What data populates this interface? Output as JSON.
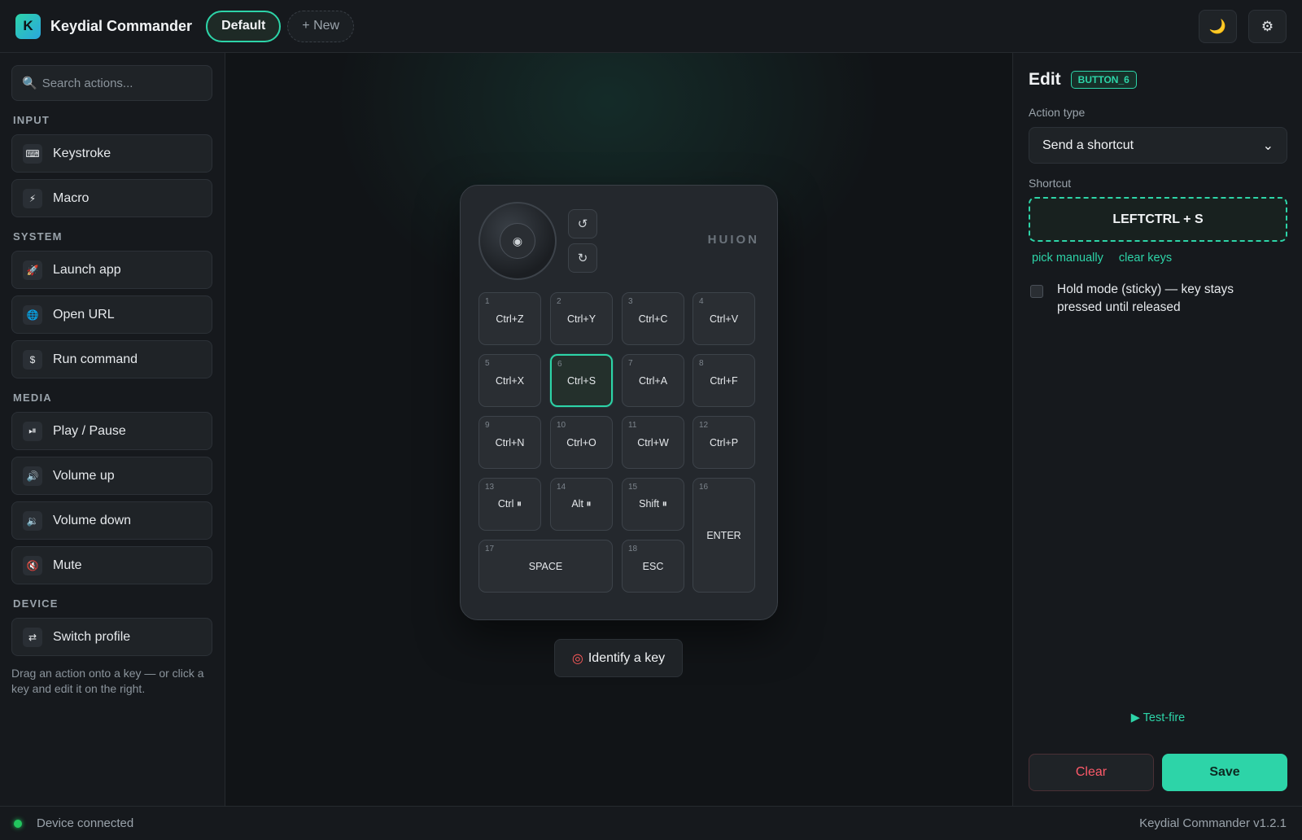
{
  "header": {
    "logo_letter": "K",
    "app_title": "Keydial Commander",
    "profiles": [
      "Default"
    ],
    "new_profile_label": "+ New",
    "theme_icon": "moon-icon",
    "settings_icon": "gear-icon"
  },
  "sidebar": {
    "search_placeholder": "Search actions...",
    "sections": [
      {
        "title": "INPUT",
        "items": [
          {
            "label": "Keystroke",
            "icon": "⌨"
          },
          {
            "label": "Macro",
            "icon": "⚡"
          }
        ]
      },
      {
        "title": "SYSTEM",
        "items": [
          {
            "label": "Launch app",
            "icon": "🚀"
          },
          {
            "label": "Open URL",
            "icon": "🌐"
          },
          {
            "label": "Run command",
            "icon": "$"
          }
        ]
      },
      {
        "title": "MEDIA",
        "items": [
          {
            "label": "Play / Pause",
            "icon": "⏯"
          },
          {
            "label": "Volume up",
            "icon": "🔊"
          },
          {
            "label": "Volume down",
            "icon": "🔉"
          },
          {
            "label": "Mute",
            "icon": "🔇"
          }
        ]
      },
      {
        "title": "DEVICE",
        "items": [
          {
            "label": "Switch profile",
            "icon": "⇄"
          }
        ]
      }
    ],
    "hint": "Drag an action onto a key — or click a key and edit it on the right."
  },
  "device": {
    "brand": "HUION",
    "keys": [
      {
        "num": "1",
        "label": "Ctrl+Z"
      },
      {
        "num": "2",
        "label": "Ctrl+Y"
      },
      {
        "num": "3",
        "label": "Ctrl+C"
      },
      {
        "num": "4",
        "label": "Ctrl+V"
      },
      {
        "num": "5",
        "label": "Ctrl+X"
      },
      {
        "num": "6",
        "label": "Ctrl+S",
        "selected": true
      },
      {
        "num": "7",
        "label": "Ctrl+A"
      },
      {
        "num": "8",
        "label": "Ctrl+F"
      },
      {
        "num": "9",
        "label": "Ctrl+N"
      },
      {
        "num": "10",
        "label": "Ctrl+O"
      },
      {
        "num": "11",
        "label": "Ctrl+W"
      },
      {
        "num": "12",
        "label": "Ctrl+P"
      },
      {
        "num": "13",
        "label": "Ctrl ⏸"
      },
      {
        "num": "14",
        "label": "Alt ⏸"
      },
      {
        "num": "15",
        "label": "Shift ⏸"
      },
      {
        "num": "16",
        "label": "ENTER"
      },
      {
        "num": "17",
        "label": "SPACE"
      },
      {
        "num": "18",
        "label": "ESC"
      }
    ],
    "identify_label": "Identify a key"
  },
  "panel": {
    "title": "Edit",
    "key_id": "BUTTON_6",
    "action_type_label": "Action type",
    "action_type_value": "Send a shortcut",
    "shortcut_label": "Shortcut",
    "shortcut_value": "LEFTCTRL + S",
    "pick_manually": "pick manually",
    "clear_keys": "clear keys",
    "hold_mode_label": "Hold mode (sticky) — key stays pressed until released",
    "hold_mode_checked": false,
    "test_fire": "▶ Test-fire",
    "clear_button": "Clear",
    "save_button": "Save"
  },
  "footer": {
    "status": "Device connected",
    "version": "Keydial Commander v1.2.1"
  },
  "colors": {
    "accent": "#2dd4a8",
    "danger": "#ff5a6a",
    "connected": "#22c55e"
  }
}
